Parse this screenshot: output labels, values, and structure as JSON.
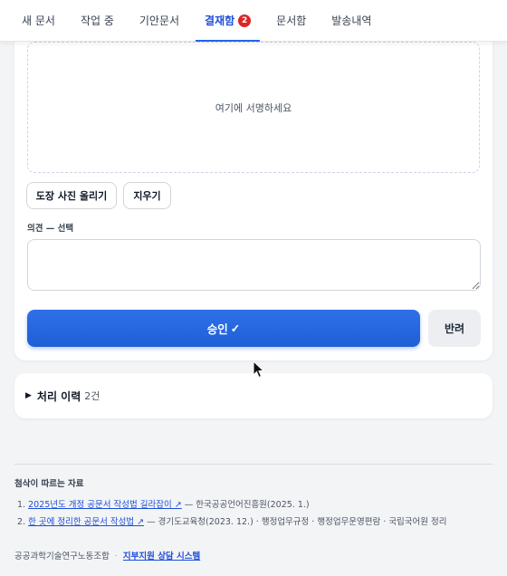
{
  "tabs": [
    {
      "label": "새 문서"
    },
    {
      "label": "작업 중"
    },
    {
      "label": "기안문서"
    },
    {
      "label": "결재함",
      "badge": "2",
      "active": true
    },
    {
      "label": "문서함"
    },
    {
      "label": "발송내역"
    }
  ],
  "signature": {
    "placeholder": "여기에 서명하세요",
    "upload_stamp_label": "도장 사진 올리기",
    "clear_label": "지우기"
  },
  "opinion": {
    "label": "의견 — 선택",
    "value": ""
  },
  "actions": {
    "approve_label": "승인",
    "approve_icon": "✓",
    "reject_label": "반려"
  },
  "history": {
    "title": "처리 이력",
    "count": "2건"
  },
  "references": {
    "title": "첨삭이 따르는 자료",
    "items": [
      {
        "num": "1.",
        "link": "2025년도 개정 공문서 작성법 길라잡이 ↗",
        "rest": " — 한국공공언어진흥원(2025. 1.)"
      },
      {
        "num": "2.",
        "link": "한 곳에 정리한 공문서 작성법 ↗",
        "rest": " — 경기도교육청(2023. 12.) · 행정업무규정 · 행정업무운영편람 · 국립국어원 정리"
      }
    ]
  },
  "footer": {
    "org": "공공과학기술연구노동조합",
    "separator": "·",
    "link": "지부지원 상담 시스템"
  },
  "colors": {
    "accent": "#2563eb",
    "badge": "#dc2626",
    "background": "#f3f4f6"
  }
}
